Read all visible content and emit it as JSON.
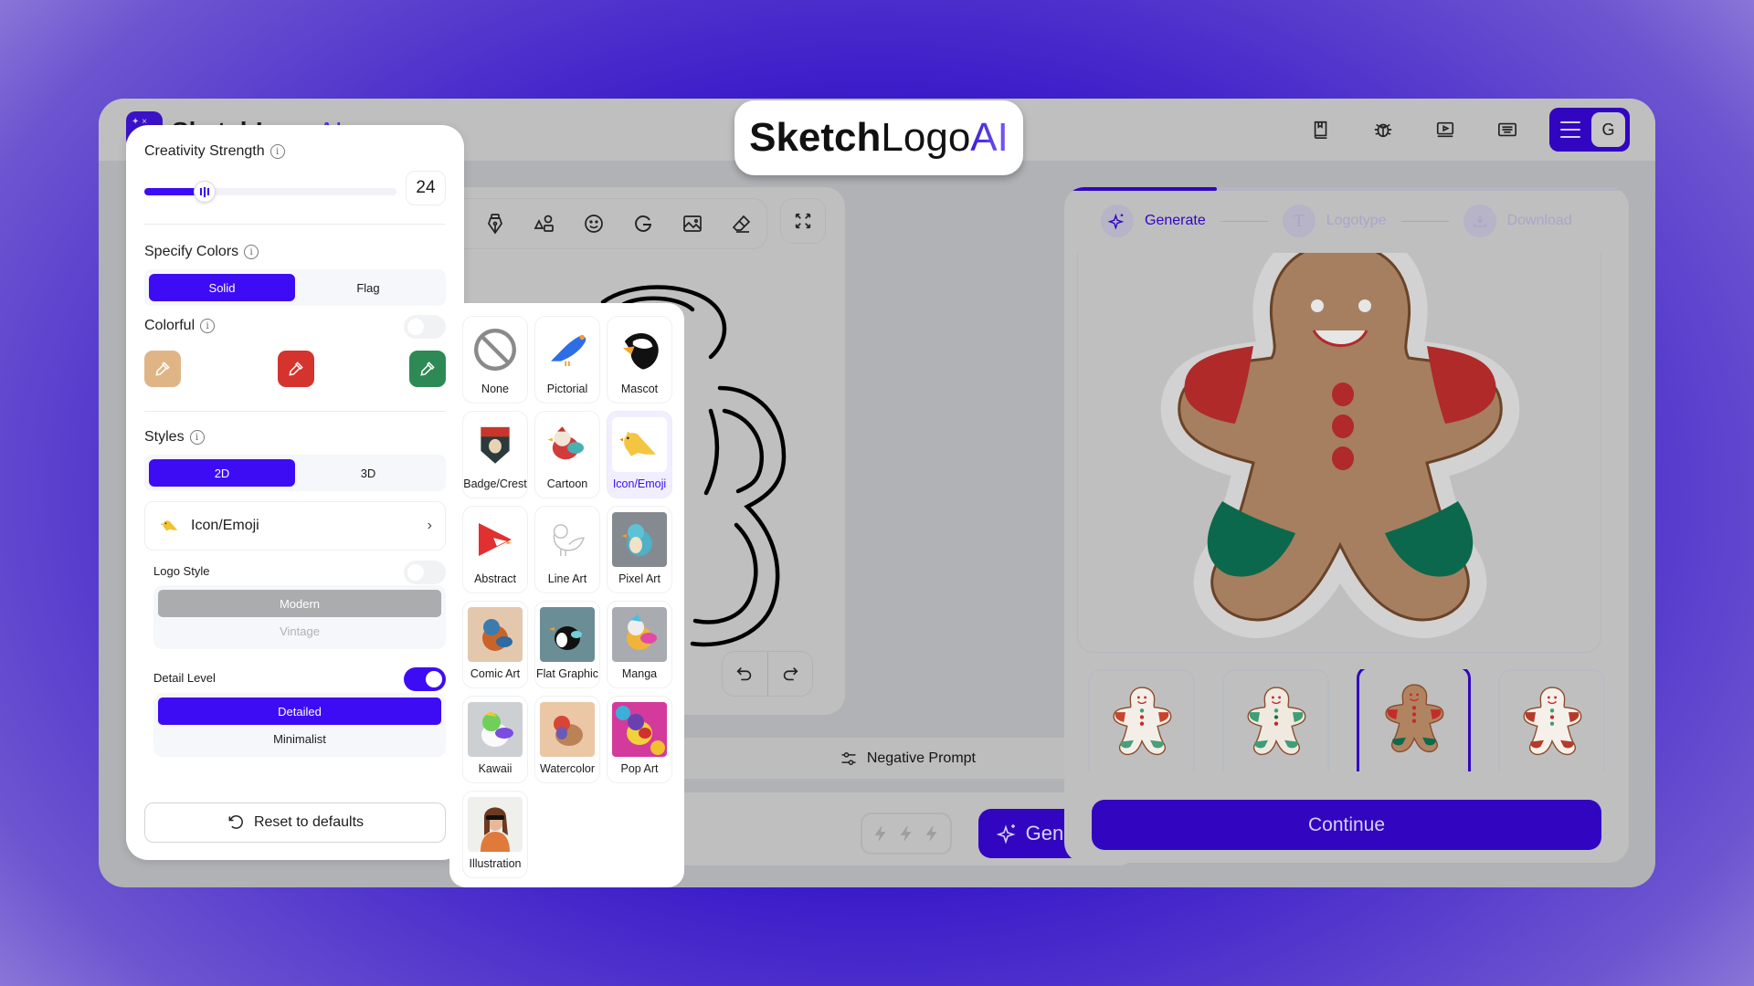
{
  "app": {
    "brand": {
      "part1": "Sketch",
      "part2": "Logo",
      "part3": "AI"
    },
    "header_icons": [
      "book-icon",
      "bug-icon",
      "video-tutorial-icon",
      "keyboard-icon"
    ],
    "avatar_letter": "G"
  },
  "canvas": {
    "tools": [
      "pen-tool",
      "shapes-tool",
      "emoji-tool",
      "google-logo-tool",
      "image-tool",
      "eraser-tool"
    ],
    "negative_prompt_label": "Negative Prompt",
    "generate_label": "Generate",
    "credits_bolts": 3
  },
  "right_panel": {
    "progress": 0.27,
    "steps": [
      {
        "label": "Generate",
        "state": "active"
      },
      {
        "label": "Logotype",
        "state": "inactive"
      },
      {
        "label": "Download",
        "state": "inactive"
      }
    ],
    "thumbnails": [
      {
        "variant": "white-red-green",
        "selected": false
      },
      {
        "variant": "white-green",
        "selected": false
      },
      {
        "variant": "brown-red-green",
        "selected": true
      },
      {
        "variant": "outline-red",
        "selected": false
      }
    ],
    "continue_label": "Continue"
  },
  "settings": {
    "creativity": {
      "label": "Creativity Strength",
      "value": "24",
      "fraction": 0.24
    },
    "specify_colors": {
      "label": "Specify Colors",
      "options": [
        "Solid",
        "Flag"
      ],
      "selected": "Solid"
    },
    "colorful": {
      "label": "Colorful",
      "enabled": false
    },
    "swatches": [
      "#e0b586",
      "#d4332e",
      "#2e8a55"
    ],
    "styles": {
      "label": "Styles",
      "options": [
        "2D",
        "3D"
      ],
      "selected": "2D"
    },
    "current_style": "Icon/Emoji",
    "logo_style": {
      "label": "Logo Style",
      "enabled": false,
      "options": [
        "Modern",
        "Vintage"
      ],
      "selected": "Modern"
    },
    "detail_level": {
      "label": "Detail Level",
      "enabled": true,
      "options": [
        "Detailed",
        "Minimalist"
      ],
      "selected": "Detailed"
    },
    "reset_label": "Reset to defaults"
  },
  "style_picker": {
    "selected": "Icon/Emoji",
    "items": [
      {
        "label": "None"
      },
      {
        "label": "Pictorial"
      },
      {
        "label": "Mascot"
      },
      {
        "label": "Badge/Crest"
      },
      {
        "label": "Cartoon"
      },
      {
        "label": "Icon/Emoji"
      },
      {
        "label": "Abstract"
      },
      {
        "label": "Line Art"
      },
      {
        "label": "Pixel Art"
      },
      {
        "label": "Comic Art"
      },
      {
        "label": "Flat Graphic"
      },
      {
        "label": "Manga"
      },
      {
        "label": "Kawaii"
      },
      {
        "label": "Watercolor"
      },
      {
        "label": "Pop Art"
      },
      {
        "label": "Illustration"
      }
    ]
  }
}
